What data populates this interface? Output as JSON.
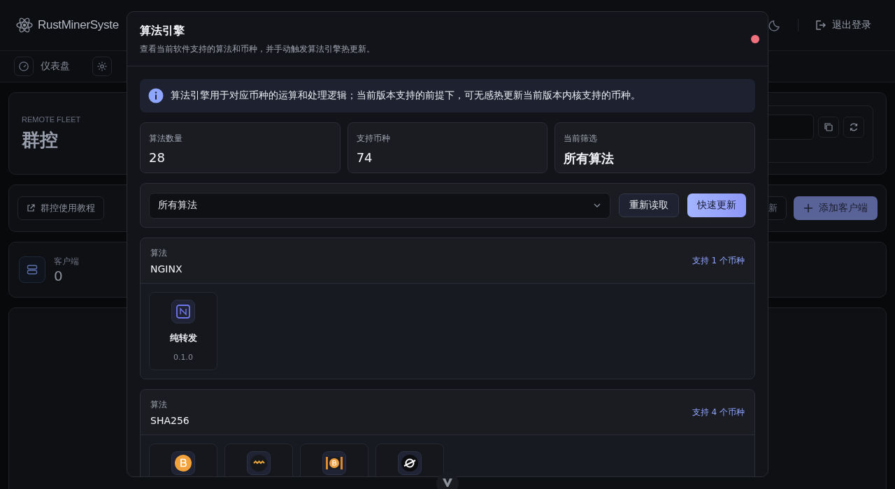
{
  "header": {
    "brand": "RustMinerSyste",
    "logout": "退出登录"
  },
  "nav": {
    "items": [
      {
        "label": "仪表盘",
        "kind": "gauge"
      },
      {
        "kind": "gear"
      }
    ]
  },
  "page": {
    "eyebrow": "REMOTE FLEET",
    "title": "群控",
    "tutorial_button": "群控使用教程",
    "partial_button": "新",
    "add_button": "添加客户端",
    "clients_label": "客户端",
    "clients_count": "0"
  },
  "modal": {
    "title": "算法引擎",
    "subtitle": "查看当前软件支持的算法和币种，并手动触发算法引擎热更新。",
    "notice": "算法引擎用于对应币种的运算和处理逻辑；当前版本支持的前提下，可无感热更新当前版本内核支持的币种。",
    "stats": [
      {
        "label": "算法数量",
        "value": "28",
        "kind": "number"
      },
      {
        "label": "支持币种",
        "value": "74",
        "kind": "number"
      },
      {
        "label": "当前筛选",
        "value": "所有算法",
        "kind": "text"
      }
    ],
    "filter": {
      "value": "所有算法"
    },
    "buttons": [
      {
        "label": "重新读取",
        "kind": "secondary"
      },
      {
        "label": "快速更新",
        "kind": "primary"
      }
    ],
    "algorithms": [
      {
        "caption": "算法",
        "name": "NGINX",
        "support": "支持 1 个币种",
        "coins": [
          {
            "kind": "relay",
            "name": "纯转发",
            "version": "0.1.0"
          }
        ]
      },
      {
        "caption": "算法",
        "name": "SHA256",
        "support": "支持 4 个币种",
        "coins": [
          {
            "kind": "bitcoin"
          },
          {
            "kind": "wave"
          },
          {
            "kind": "bitcoin-cash"
          },
          {
            "kind": "ring"
          }
        ]
      }
    ]
  }
}
